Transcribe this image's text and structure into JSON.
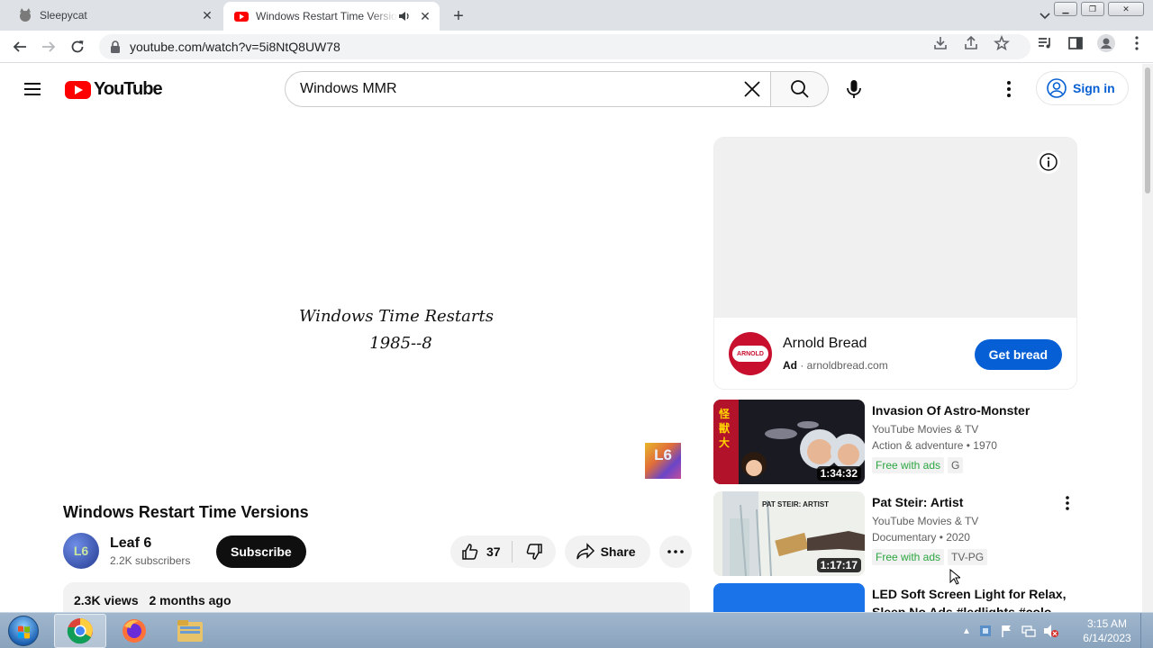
{
  "browser": {
    "tabs": [
      {
        "title": "Sleepycat",
        "active": false
      },
      {
        "title": "Windows Restart Time Versions",
        "active": true
      }
    ],
    "url": "youtube.com/watch?v=5i8NtQ8UW78"
  },
  "masthead": {
    "logo_text": "YouTube",
    "search_query": "Windows MMR",
    "signin_label": "Sign in"
  },
  "player": {
    "caption_line1": "Windows Time Restarts",
    "caption_line2": "1985--8",
    "watermark": "L6"
  },
  "video": {
    "title": "Windows Restart Time Versions",
    "channel": "Leaf 6",
    "subscribers": "2.2K subscribers",
    "avatar_text": "L6",
    "subscribe_label": "Subscribe",
    "likes": "37",
    "share_label": "Share",
    "views": "2.3K views",
    "age": "2 months ago"
  },
  "ad": {
    "advertiser": "Arnold Bread",
    "ad_label": "Ad",
    "domain": "arnoldbread.com",
    "cta": "Get bread",
    "logo_text": "ARNOLD"
  },
  "recommendations": [
    {
      "title": "Invasion Of Astro-Monster",
      "channel": "YouTube Movies & TV",
      "category": "Action & adventure • 1970",
      "duration": "1:34:32",
      "badges": [
        "Free with ads",
        "G"
      ]
    },
    {
      "title": "Pat Steir: Artist",
      "channel": "YouTube Movies & TV",
      "category": "Documentary • 2020",
      "duration": "1:17:17",
      "badges": [
        "Free with ads",
        "TV-PG"
      ],
      "thumb_text": "PAT STEIR: ARTIST"
    },
    {
      "title": "LED Soft Screen Light for Relax, Sleep No Ads #ledlights #colo"
    }
  ],
  "taskbar": {
    "time": "3:15 AM",
    "date": "6/14/2023"
  }
}
